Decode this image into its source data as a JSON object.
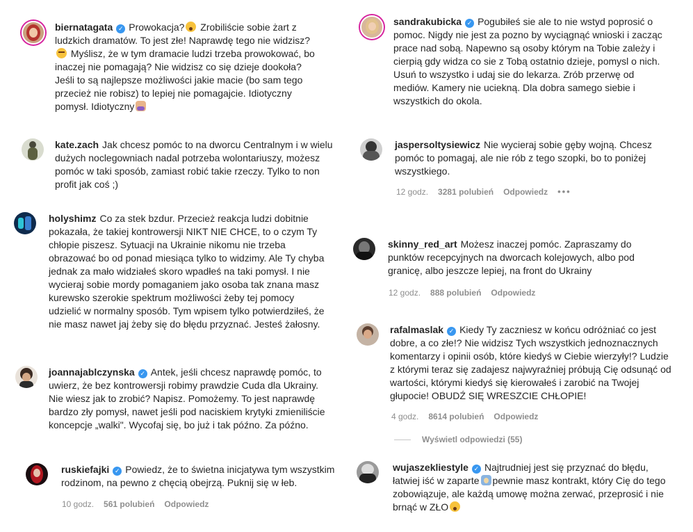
{
  "left": [
    {
      "username": "biernatagata",
      "verified": true,
      "avatar_icon": "profile-photo-red-hair",
      "segments": [
        {
          "t": "Prowokacja?"
        },
        {
          "emoji": "shocked-face-emoji"
        },
        {
          "t": " Zrobiliście sobie żart z ludzkich dramatów. To jest złe! Naprawdę tego nie widzisz?"
        },
        {
          "emoji": "flushed-face-emoji"
        },
        {
          "t": " Myślisz, że w tym dramacie ludzi trzeba prowokować, bo inaczej nie pomagają? Nie widzisz co się dzieje dookoła? Jeśli to są najlepsze możliwości jakie macie (bo sam tego przecież nie robisz) to lepiej nie pomagajcie. Idiotyczny pomysł. Idiotyczny"
        },
        {
          "emoji": "facepalm-emoji"
        }
      ]
    },
    {
      "username": "kate.zach",
      "verified": false,
      "avatar_icon": "profile-photo-figure",
      "segments": [
        {
          "t": "Jak chcesz pomóc to na dworcu Centralnym i w wielu dużych noclegowniach nadal potrzeba wolontariuszy, możesz pomóc w taki sposób, zamiast robić takie rzeczy. Tylko to non profit jak coś ;)"
        }
      ]
    },
    {
      "username": "holyshimz",
      "verified": false,
      "avatar_icon": "profile-photo-stage",
      "segments": [
        {
          "t": "Co za stek bzdur. Przecież reakcja ludzi dobitnie pokazała, że takiej kontrowersji NIKT NIE CHCE, to o czym Ty chłopie piszesz. Sytuacji na Ukrainie nikomu nie trzeba obrazować bo od ponad miesiąca tylko to widzimy. Ale Ty chyba jednak za mało widziałeś skoro wpadłeś na taki pomysł. I nie wycieraj sobie mordy pomaganiem jako osoba tak znana masz kurewsko szerokie spektrum możliwości żeby tej pomocy udzielić w normalny sposób. Tym wpisem tylko potwierdziłeś, że nie masz nawet jaj żeby się do błędu przyznać. Jesteś żałosny."
        }
      ]
    },
    {
      "username": "joannajablczynska",
      "verified": true,
      "avatar_icon": "profile-photo-woman",
      "segments": [
        {
          "t": "Antek, jeśli chcesz naprawdę pomóc, to uwierz, że bez kontrowersji robimy prawdzie Cuda dla Ukrainy. Nie wiesz jak to zrobić? Napisz. Pomożemy. To jest naprawdę bardzo zły pomysł, nawet jeśli pod naciskiem krytyki zmieniliście koncepcje „walki\". Wycofaj się, bo już i tak późno. Za późno."
        }
      ]
    },
    {
      "username": "ruskiefajki",
      "verified": true,
      "avatar_icon": "profile-photo-red",
      "segments": [
        {
          "t": "Powiedz, że to świetna inicjatywa tym wszystkim rodzinom, na pewno z chęcią obejrzą. Puknij się w łeb."
        }
      ],
      "meta": {
        "time": "10 godz.",
        "likes": "561 polubień",
        "reply": "Odpowiedz"
      }
    }
  ],
  "right": [
    {
      "username": "sandrakubicka",
      "verified": true,
      "avatar_icon": "profile-photo-blonde",
      "segments": [
        {
          "t": "Pogubiłeś sie ale to nie wstyd poprosić o pomoc. Nigdy nie jest za pozno by wyciągnąć wnioski i zacząc prace nad sobą. Napewno są osoby którym na Tobie zależy i cierpią gdy widza co sie z Tobą ostatnio dzieje, pomysl o nich. Usuń to wszystko i udaj sie do lekarza. Zrób przerwę od mediów. Kamery nie uciekną. Dla dobra samego siebie i wszystkich do okola."
        }
      ]
    },
    {
      "username": "jaspersoltysiewicz",
      "verified": false,
      "avatar_icon": "profile-photo-man-grey",
      "segments": [
        {
          "t": "Nie wycieraj sobie gęby wojną. Chcesz pomóc to pomagaj, ale nie rób z tego szopki, bo to poniżej wszystkiego."
        }
      ],
      "meta": {
        "time": "12 godz.",
        "likes": "3281 polubień",
        "reply": "Odpowiedz",
        "more": "•••"
      }
    },
    {
      "username": "skinny_red_art",
      "verified": false,
      "avatar_icon": "profile-photo-dark",
      "segments": [
        {
          "t": "Możesz inaczej pomóc. Zapraszamy do punktów recepcyjnych na dworcach kolejowych, albo pod granicę, albo jeszcze lepiej, na front do Ukrainy"
        }
      ],
      "meta": {
        "time": "12 godz.",
        "likes": "888 polubień",
        "reply": "Odpowiedz"
      }
    },
    {
      "username": "rafalmaslak",
      "verified": true,
      "avatar_icon": "profile-photo-man",
      "segments": [
        {
          "t": "Kiedy Ty zaczniesz w końcu odróżniać co jest dobre, a co złe!? Nie widzisz Tych wszystkich jednoznacznych komentarzy i opinii osób, które kiedyś w Ciebie wierzyły!? Ludzie z którymi teraz się zadajesz najwyraźniej próbują Cię odsunąć od wartości, którymi kiedyś się kierowałeś i zarobić na Twojej głupocie! OBUDŹ SIĘ WRESZCIE CHŁOPIE!"
        }
      ],
      "meta": {
        "time": "4 godz.",
        "likes": "8614 polubień",
        "reply": "Odpowiedz"
      },
      "view_replies": "Wyświetl odpowiedzi (55)"
    },
    {
      "username": "wujaszekliestyle",
      "verified": true,
      "avatar_icon": "profile-photo-bw",
      "segments": [
        {
          "t": "Najtrudniej jest się przyznać do błędu, łatwiej iść w zaparte"
        },
        {
          "emoji": "screaming-emoji"
        },
        {
          "t": "pewnie masz kontrakt, który Cię do tego zobowiązuje, ale każdą umowę można zerwać, przeprosić i nie brnąć w ZŁO"
        },
        {
          "emoji": "shocked-face-emoji"
        }
      ]
    }
  ],
  "colors": {
    "text": "#262626",
    "muted": "#8e8e8e",
    "verified": "#3897f0",
    "story_ring": "#d6249f"
  }
}
